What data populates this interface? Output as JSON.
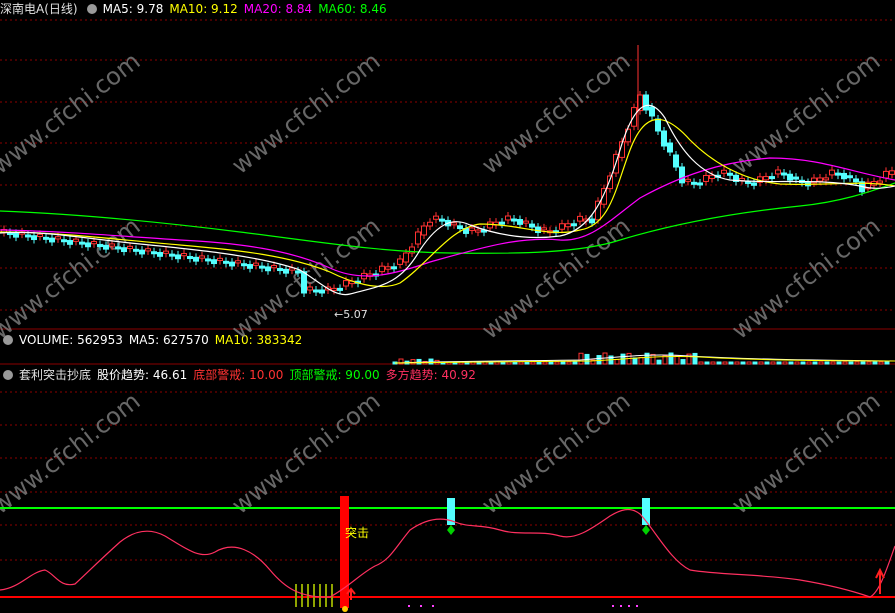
{
  "main": {
    "title": "深南电A(日线)",
    "ma5": "MA5: 9.78",
    "ma10": "MA10: 9.12",
    "ma20": "MA20: 8.84",
    "ma60": "MA60: 8.46",
    "low_label": "←5.07"
  },
  "volume": {
    "label": "VOLUME: 562953",
    "ma5": "MA5: 627570",
    "ma10": "MA10: 383342"
  },
  "indicator": {
    "name": "套利突击抄底",
    "trend": "股价趋势: 46.61",
    "bottom_warn": "底部警戒: 10.00",
    "top_warn": "顶部警戒: 90.00",
    "bull_trend": "多方趋势: 40.92",
    "signal": "突击"
  },
  "watermark": "www.cfchi.com",
  "colors": {
    "bg": "#000000",
    "up": "#ff3232",
    "down": "#54ffff",
    "ma5": "#ffffff",
    "ma10": "#ffff00",
    "ma20": "#ff00ff",
    "ma60": "#00ff00",
    "grid": "#8b0000"
  }
}
